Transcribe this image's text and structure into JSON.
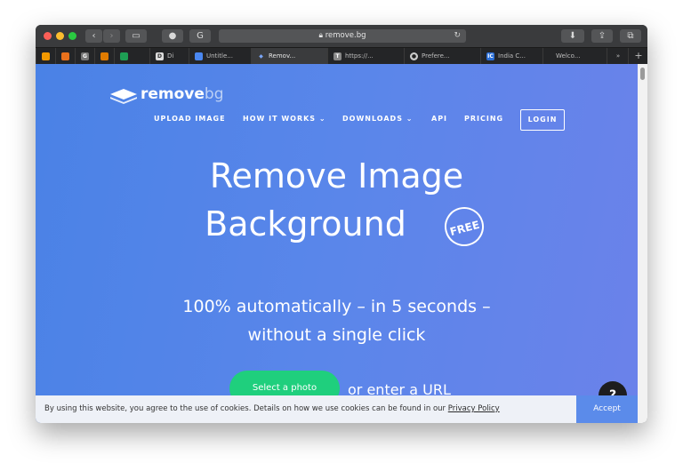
{
  "browser": {
    "address": "remove.bg",
    "tabs": [
      {
        "label": "",
        "favicon": "analytics-icon"
      },
      {
        "label": "",
        "favicon": "extension-icon"
      },
      {
        "label": "",
        "favicon": "g-icon"
      },
      {
        "label": "",
        "favicon": "slides-icon"
      },
      {
        "label": "",
        "favicon": "sheets-icon"
      },
      {
        "label": "Di",
        "favicon": "d-icon"
      },
      {
        "label": "Untitle...",
        "favicon": "docs-icon"
      },
      {
        "label": "Remov...",
        "favicon": "removebg-icon"
      },
      {
        "label": "https://...",
        "favicon": "t-icon"
      },
      {
        "label": "Prefere...",
        "favicon": "github-icon"
      },
      {
        "label": "India C...",
        "favicon": "ic-icon"
      },
      {
        "label": "Welco...",
        "favicon": ""
      }
    ]
  },
  "site": {
    "logo_main": "remove",
    "logo_suffix": "bg",
    "nav": {
      "upload": "UPLOAD IMAGE",
      "how": "HOW IT WORKS ⌄",
      "downloads": "DOWNLOADS ⌄",
      "api": "API",
      "pricing": "PRICING",
      "login": "LOGIN"
    },
    "hero": {
      "line1": "Remove Image",
      "line2": "Background",
      "badge": "FREE",
      "sub1": "100% automatically – in 5 seconds –",
      "sub2": "without a single click",
      "select_button": "Select a photo",
      "or_text": "or ",
      "url_link": "enter a URL"
    },
    "help": "?",
    "cookie": {
      "text": "By using this website, you agree to the use of cookies. Details on how we use cookies can be found in our ",
      "policy": "Privacy Policy",
      "accept": "Accept"
    }
  }
}
